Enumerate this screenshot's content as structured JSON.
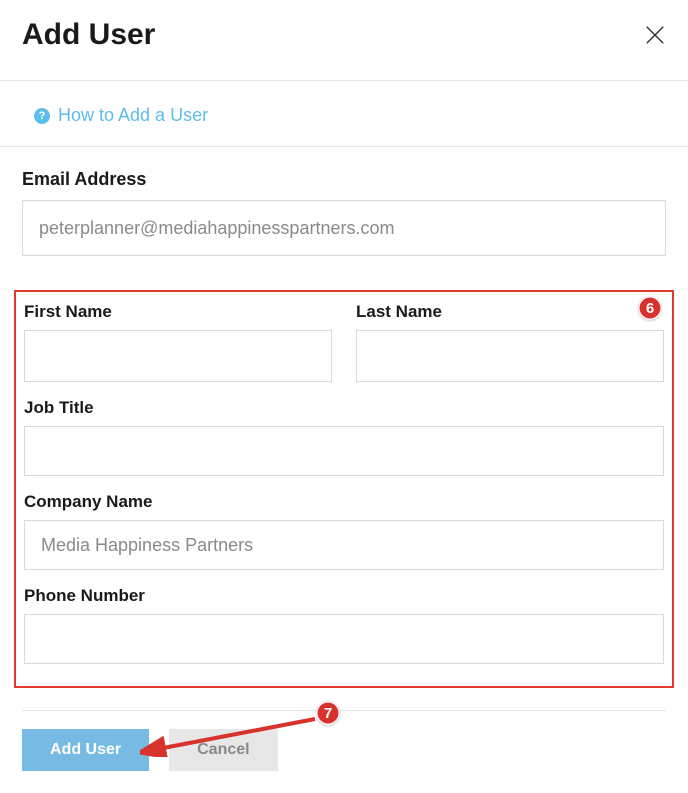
{
  "header": {
    "title": "Add User"
  },
  "help": {
    "text": "How to Add a User"
  },
  "form": {
    "email_label": "Email Address",
    "email_value": "peterplanner@mediahappinesspartners.com",
    "first_name_label": "First Name",
    "first_name_value": "",
    "last_name_label": "Last Name",
    "last_name_value": "",
    "job_title_label": "Job Title",
    "job_title_value": "",
    "company_label": "Company Name",
    "company_value": "Media Happiness Partners",
    "phone_label": "Phone Number",
    "phone_value": ""
  },
  "footer": {
    "add_label": "Add User",
    "cancel_label": "Cancel"
  },
  "callouts": {
    "six": "6",
    "seven": "7"
  }
}
